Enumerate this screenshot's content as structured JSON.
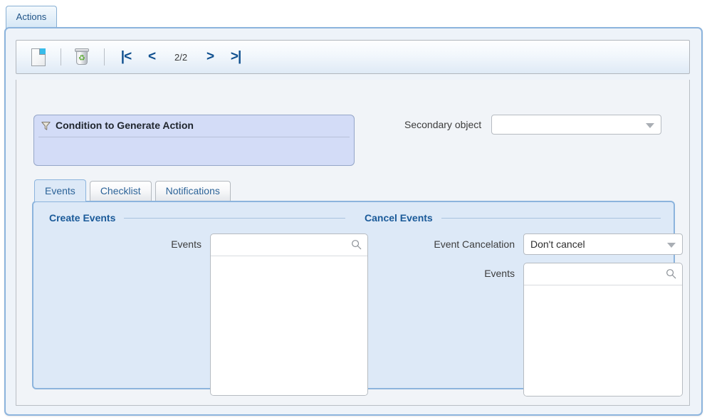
{
  "window": {
    "tab_label": "Actions"
  },
  "toolbar": {
    "new_icon": "new-document-icon",
    "delete_icon": "recycle-bin-icon",
    "pager": {
      "first_label": "|<",
      "prev_label": "<",
      "count_label": "2/2",
      "next_label": ">",
      "last_label": ">|"
    }
  },
  "condition": {
    "icon": "filter-funnel-icon",
    "title": "Condition to Generate Action"
  },
  "secondary": {
    "label": "Secondary object",
    "value": "",
    "caret_icon": "chevron-down-icon"
  },
  "tabs": [
    {
      "label": "Events",
      "active": true
    },
    {
      "label": "Checklist",
      "active": false
    },
    {
      "label": "Notifications",
      "active": false
    }
  ],
  "create_events": {
    "legend": "Create Events",
    "events_label": "Events",
    "events_value": "",
    "search_icon": "search-icon"
  },
  "cancel_events": {
    "legend": "Cancel Events",
    "cancelation_label": "Event Cancelation",
    "cancelation_value": "Don't cancel",
    "caret_icon": "chevron-down-icon",
    "events_label": "Events",
    "events_value": "",
    "search_icon": "search-icon"
  },
  "colors": {
    "accent_blue": "#1a5a99",
    "panel_blue": "#dde9f7",
    "condition_lavender": "#d3dcf7",
    "border_blue": "#8cb4dd"
  }
}
